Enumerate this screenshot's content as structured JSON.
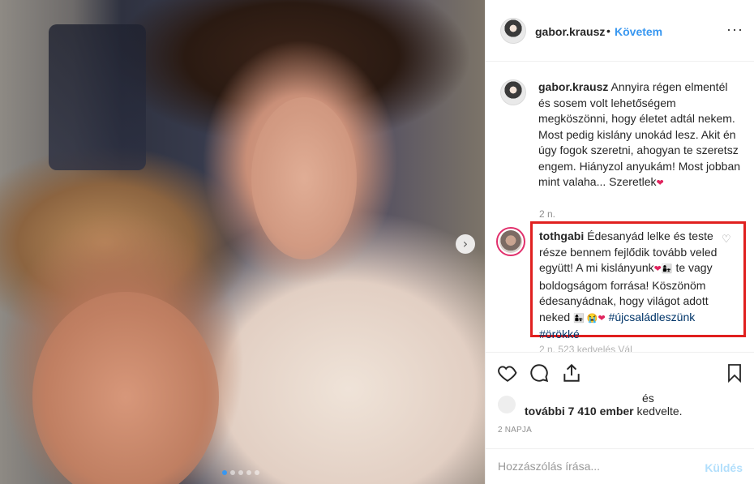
{
  "post": {
    "author": "gabor.krausz",
    "separator": "•",
    "follow_label": "Követem",
    "more_label": "···",
    "caption": {
      "author": "gabor.krausz",
      "text": "Annyira régen elmentél és sosem volt lehetőségem megköszönni, hogy életet adtál nekem. Most pedig kislány unokád lesz. Akit én úgy fogok szeretni, ahogyan te szeretsz engem. Hiányzol anyukám! Most jobban mint valaha... Szeretlek",
      "emoji": "❤",
      "time": "2 n."
    },
    "comment": {
      "author": "tothgabi",
      "line1": "Édesanyád lelke és teste része bennem fejlődik tovább veled együtt! A mi kislányunk",
      "emoji1": "❤👩‍👧",
      "line2": "te vagy boldogságom forrása! Köszönöm édesanyádnak, hogy világot adott neked",
      "emoji2": "👩‍👧 😭❤",
      "hashtags": "#újcsaládleszünk #örökké",
      "reply_row": "2 n. 523 kedvelés Vál"
    },
    "likes": {
      "and": "és",
      "count_text": "további 7 410 ember",
      "suffix": "kedvelte."
    },
    "date": "2 NAPJA",
    "comment_input_placeholder": "Hozzászólás írása...",
    "post_button_label": "Küldés",
    "carousel": {
      "slides": 5,
      "active": 0
    }
  },
  "colors": {
    "link_blue": "#3897f0",
    "highlight_red": "#e0201f",
    "hashtag": "#003569"
  }
}
